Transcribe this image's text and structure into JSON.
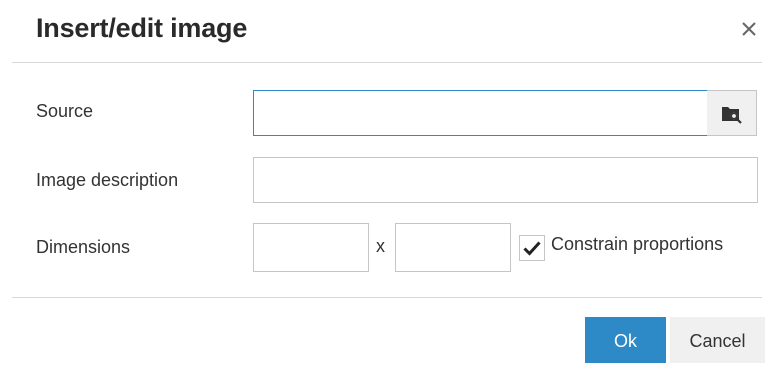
{
  "dialog": {
    "title": "Insert/edit image",
    "close_icon": "close-icon"
  },
  "form": {
    "source": {
      "label": "Source",
      "value": "",
      "browse_icon": "folder-search-icon"
    },
    "description": {
      "label": "Image description",
      "value": ""
    },
    "dimensions": {
      "label": "Dimensions",
      "width_value": "",
      "height_value": "",
      "separator": "x",
      "constrain_label": "Constrain proportions",
      "constrain_checked": true
    }
  },
  "footer": {
    "ok_label": "Ok",
    "cancel_label": "Cancel"
  },
  "colors": {
    "accent": "#2d8ac7",
    "button_gray": "#f0f0f0",
    "border": "#c5c5c5",
    "divider": "#d6d6d6"
  }
}
